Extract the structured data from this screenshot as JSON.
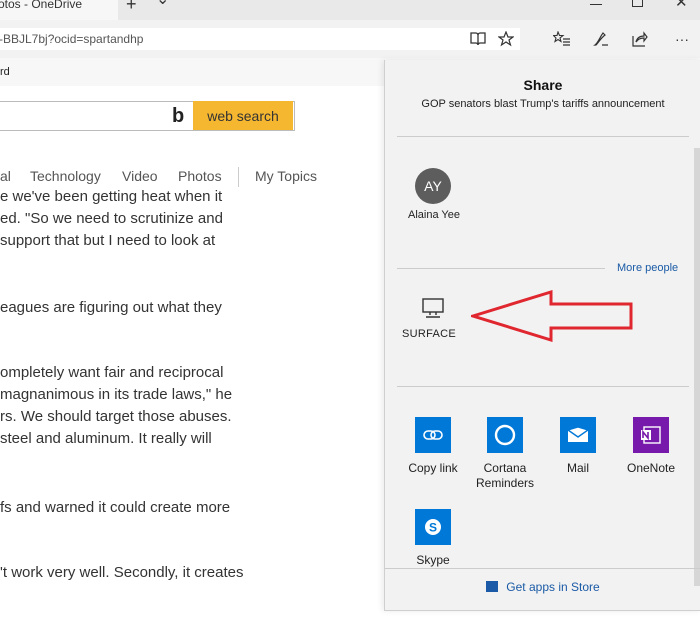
{
  "browser": {
    "tab_title": "otos - OneDrive",
    "new_tab_symbol": "+",
    "tab_menu_symbol": "⌄",
    "url": "-BBJL7bj?ocid=spartandhp",
    "favorites_fragment": "rd"
  },
  "page": {
    "search_button_label": "web search",
    "bing_logo_letter": "b",
    "nav": [
      "al",
      "Technology",
      "Video",
      "Photos",
      "My Topics"
    ],
    "article_lines": [
      "e we've been getting heat when it",
      "ed. \"So we need to scrutinize and",
      "support that but I need to look at",
      "eagues are figuring out what they",
      "ompletely want fair and reciprocal",
      " magnanimous in its trade laws,\" he",
      "rs. We should target those abuses.",
      " steel and aluminum. It really will",
      "fs and warned it could create more",
      "'t work very well. Secondly, it creates"
    ]
  },
  "share": {
    "title": "Share",
    "subtitle": "GOP senators blast Trump's tariffs announcement",
    "contact": {
      "initials": "AY",
      "name": "Alaina Yee"
    },
    "more_people_label": "More people",
    "device_label": "SURFACE",
    "apps": [
      {
        "name": "Copy link",
        "icon": "link-icon",
        "color": "#0078d7"
      },
      {
        "name": "Cortana\nReminders",
        "icon": "cortana-icon",
        "color": "#0078d7"
      },
      {
        "name": "Mail",
        "icon": "mail-icon",
        "color": "#0078d7"
      },
      {
        "name": "OneNote",
        "icon": "onenote-icon",
        "color": "#7719aa"
      },
      {
        "name": "Skype",
        "icon": "skype-icon",
        "color": "#0078d7"
      }
    ],
    "store_label": "Get apps in Store"
  },
  "colors": {
    "accent_blue": "#0078d7",
    "onenote_purple": "#7719aa",
    "search_orange": "#f5b730",
    "annotation_red": "#e0262e"
  }
}
